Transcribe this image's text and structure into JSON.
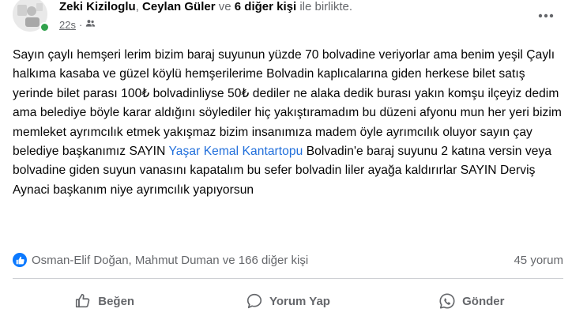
{
  "header": {
    "authors": [
      "Zeki Kiziloglu",
      "Ceylan Güler"
    ],
    "comma": ",",
    "conjunction": "ve",
    "others": "6 diğer kişi",
    "suffix": "ile birlikte.",
    "time": "22s",
    "separator": "·",
    "audience_icon": "friends-icon",
    "more_icon": "more-icon"
  },
  "post": {
    "text_before_mention": "Sayın çaylı hemşeri lerim bizim baraj suyunun yüzde 70 bolvadine veriyorlar ama benim yeşil Çaylı halkıma kasaba ve güzel köylü hemşerilerime  Bolvadin kaplıcalarına giden herkese bilet satış yerinde bilet parası 100₺ bolvadinliyse 50₺ dediler ne alaka dedik burası yakın komşu ilçeyiz dedim ama  belediye böyle karar aldığını söylediler hiç yakıştıramadım bu düzeni afyonu mun her yeri bizim memleket ayrımcılık etmek yakışmaz bizim insanımıza madem öyle ayrımcılık oluyor sayın çay belediye başkanımız SAYIN",
    "mention": "Yaşar Kemal Kantartopu",
    "text_after_mention": "Bolvadin'e baraj suyunu 2 katına versin veya bolvadine giden suyun vanasını kapatalım bu sefer bolvadin liler ayağa kaldırırlar SAYIN Derviş Aynaci başkanım niye ayrımcılık yapıyorsun"
  },
  "reactions": {
    "icon": "like-icon",
    "names": "Osman-Elif Doğan, Mahmut Duman ve 166 diğer kişi",
    "comments": "45 yorum"
  },
  "actions": [
    {
      "label": "Beğen",
      "icon": "thumbs-up-icon"
    },
    {
      "label": "Yorum Yap",
      "icon": "comment-icon"
    },
    {
      "label": "Gönder",
      "icon": "send-icon"
    }
  ],
  "colors": {
    "primary_text": "#050505",
    "secondary_text": "#65676b",
    "mention": "#216fdb",
    "like_blue": "#0b79ff",
    "online": "#31a24c",
    "divider": "#ced0d4"
  }
}
